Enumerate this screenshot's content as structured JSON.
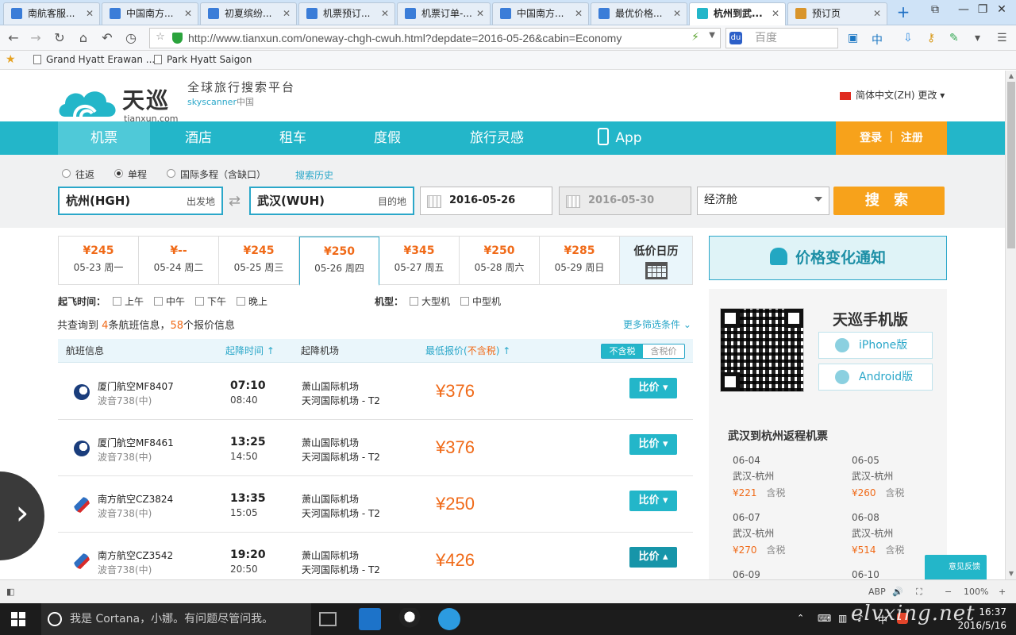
{
  "browser": {
    "tabs": [
      {
        "label": "南航客服..."
      },
      {
        "label": "中国南方..."
      },
      {
        "label": "初夏缤纷..."
      },
      {
        "label": "机票预订..."
      },
      {
        "label": "机票订单-..."
      },
      {
        "label": "中国南方..."
      },
      {
        "label": "最优价格..."
      },
      {
        "label": "杭州到武..."
      },
      {
        "label": "预订页"
      }
    ],
    "url": "http://www.tianxun.com/oneway-chgh-cwuh.html?depdate=2016-05-26&cabin=Economy",
    "search_placeholder": "百度",
    "bookmarks": [
      {
        "label": "Grand Hyatt Erawan ..."
      },
      {
        "label": "Park Hyatt Saigon"
      }
    ]
  },
  "site": {
    "logo_name": "天巡",
    "logo_domain": "tianxun.com",
    "slogan": "全球旅行搜索平台",
    "sky_prefix": "skyscanner",
    "sky_suffix": "中国",
    "lang": "简体中文(ZH) 更改 ▾"
  },
  "nav": {
    "items": [
      "机票",
      "酒店",
      "租车",
      "度假",
      "旅行灵感"
    ],
    "app": "App",
    "login": "登录 ｜ 注册"
  },
  "search": {
    "trip_types": [
      "往返",
      "单程",
      "国际多程（含缺口）"
    ],
    "history": "搜索历史",
    "from": "杭州(HGH)",
    "from_hint": "出发地",
    "to": "武汉(WUH)",
    "to_hint": "目的地",
    "depart": "2016-05-26",
    "return": "2016-05-30",
    "cabin": "经济舱",
    "submit": "搜 索"
  },
  "dates": [
    {
      "price": "¥245",
      "date": "05-23 周一"
    },
    {
      "price": "¥--",
      "date": "05-24 周二"
    },
    {
      "price": "¥245",
      "date": "05-25 周三"
    },
    {
      "price": "¥250",
      "date": "05-26 周四"
    },
    {
      "price": "¥345",
      "date": "05-27 周五"
    },
    {
      "price": "¥250",
      "date": "05-28 周六"
    },
    {
      "price": "¥285",
      "date": "05-29 周日"
    }
  ],
  "calendar_label": "低价日历",
  "filters": {
    "time_label": "起飞时间：",
    "times": [
      "上午",
      "中午",
      "下午",
      "晚上"
    ],
    "model_label": "机型：",
    "models": [
      "大型机",
      "中型机"
    ]
  },
  "summary": {
    "pre": "共查询到",
    "flights": "4",
    "mid": "条航班信息，",
    "quotes": "58",
    "post": "个报价信息",
    "more": "更多筛选条件 ⌄"
  },
  "table": {
    "col_flight": "航班信息",
    "col_time": "起降时间 ↑",
    "col_airport": "起降机场",
    "col_price": "最低报价(",
    "col_price_tax": "不含税",
    "col_price_end": ") ↑",
    "tax_on": "不含税",
    "tax_off": "含税价"
  },
  "flights": [
    {
      "airline": "厦门航空MF8407",
      "plane": "波音738(中)",
      "dep": "07:10",
      "arr": "08:40",
      "from_ap": "萧山国际机场",
      "to_ap": "天河国际机场 - T2",
      "price": "¥376",
      "btn": "比价 ▾"
    },
    {
      "airline": "厦门航空MF8461",
      "plane": "波音738(中)",
      "dep": "13:25",
      "arr": "14:50",
      "from_ap": "萧山国际机场",
      "to_ap": "天河国际机场 - T2",
      "price": "¥376",
      "btn": "比价 ▾"
    },
    {
      "airline": "南方航空CZ3824",
      "plane": "波音738(中)",
      "dep": "13:35",
      "arr": "15:05",
      "from_ap": "萧山国际机场",
      "to_ap": "天河国际机场 - T2",
      "price": "¥250",
      "btn": "比价 ▾"
    },
    {
      "airline": "南方航空CZ3542",
      "plane": "波音738(中)",
      "dep": "19:20",
      "arr": "20:50",
      "from_ap": "萧山国际机场",
      "to_ap": "天河国际机场 - T2",
      "price": "¥426",
      "btn": "比价 ▴"
    }
  ],
  "sidebar": {
    "notify": "价格变化通知",
    "mobile_title": "天巡手机版",
    "iphone": "iPhone版",
    "android": "Android版",
    "return_title": "武汉到杭州返程机票",
    "return_items": [
      {
        "date": "06-04",
        "route": "武汉-杭州",
        "price": "¥221",
        "tax": "含税"
      },
      {
        "date": "06-05",
        "route": "武汉-杭州",
        "price": "¥260",
        "tax": "含税"
      },
      {
        "date": "06-07",
        "route": "武汉-杭州",
        "price": "¥270",
        "tax": "含税"
      },
      {
        "date": "06-08",
        "route": "武汉-杭州",
        "price": "¥514",
        "tax": "含税"
      },
      {
        "date": "06-09",
        "route": "",
        "price": "",
        "tax": ""
      },
      {
        "date": "06-10",
        "route": "",
        "price": "",
        "tax": ""
      }
    ],
    "feedback": "意见反馈"
  },
  "statusbar": {
    "zoom": "100%"
  },
  "taskbar": {
    "cortana": "我是 Cortana，小娜。有问题尽管问我。",
    "time": "16:37",
    "date": "2016/5/16",
    "ime": "中",
    "watermark": "elvxing.net"
  },
  "colors": {
    "accent": "#23b6c9",
    "orange": "#f7a21b",
    "price": "#f06a18"
  }
}
